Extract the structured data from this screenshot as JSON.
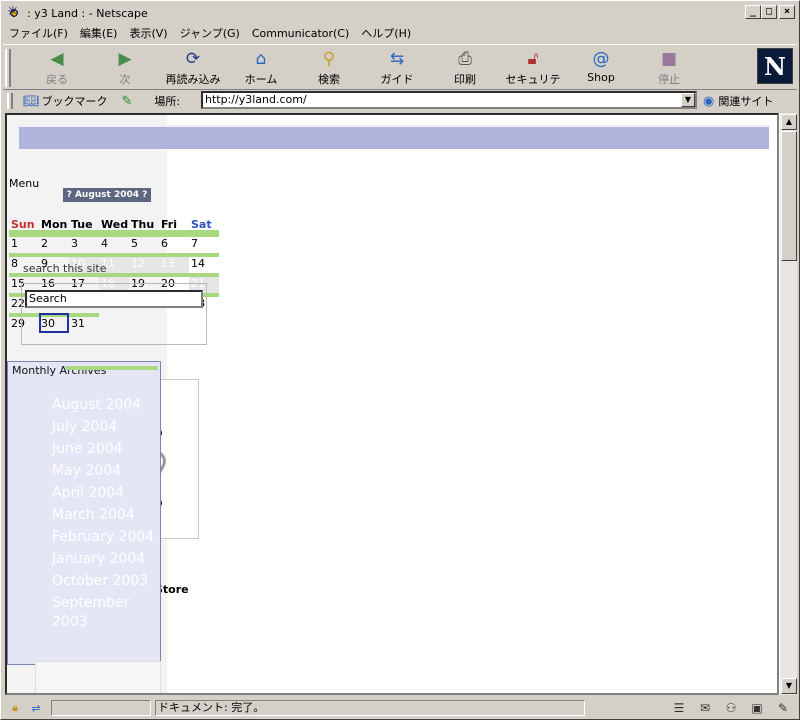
{
  "window": {
    "title": ": y3 Land : - Netscape"
  },
  "menubar": [
    "ファイル(F)",
    "編集(E)",
    "表示(V)",
    "ジャンプ(G)",
    "Communicator(C)",
    "ヘルプ(H)"
  ],
  "toolbar": {
    "back": "戻る",
    "forward": "次",
    "reload": "再読み込み",
    "home": "ホーム",
    "search": "検索",
    "guide": "ガイド",
    "print": "印刷",
    "security": "セキュリティ",
    "shop": "Shop",
    "stop": "停止",
    "logo": "N"
  },
  "location": {
    "bookmarks": "ブックマーク",
    "label": "場所:",
    "url": "http://y3land.com/",
    "related": "関連サイト"
  },
  "sidebar": {
    "menu_heading": "Menu",
    "calendar_title": "? August 2004 ?",
    "weekdays": [
      "Sun",
      "Mon",
      "Tue",
      "Wed",
      "Thu",
      "Fri",
      "Sat"
    ],
    "weeks": [
      [
        "1",
        "2",
        "3",
        "4",
        "5",
        "6",
        "7"
      ],
      [
        "8",
        "9",
        "10",
        "11",
        "12",
        "13",
        "14"
      ],
      [
        "15",
        "16",
        "17",
        "18",
        "19",
        "20",
        "21"
      ],
      [
        "22",
        "",
        "",
        "",
        "",
        "",
        "28"
      ],
      [
        "29",
        "30",
        "31",
        "",
        "",
        "",
        ""
      ]
    ],
    "search_label": "search this site",
    "search_value": "Search",
    "store_label": "Store",
    "archives_title": "Monthly Archives",
    "archives": [
      "August 2004",
      "July 2004",
      "June 2004",
      "May 2004",
      "April 2004",
      "March 2004",
      "February 2004",
      "January 2004",
      "October 2003",
      "September 2003"
    ]
  },
  "status": {
    "text": "ドキュメント: 完了。"
  },
  "colors": {
    "banner": "#b0b4dc",
    "calendar_accent": "#a8d880",
    "archives_bg": "#e4e6f6"
  }
}
